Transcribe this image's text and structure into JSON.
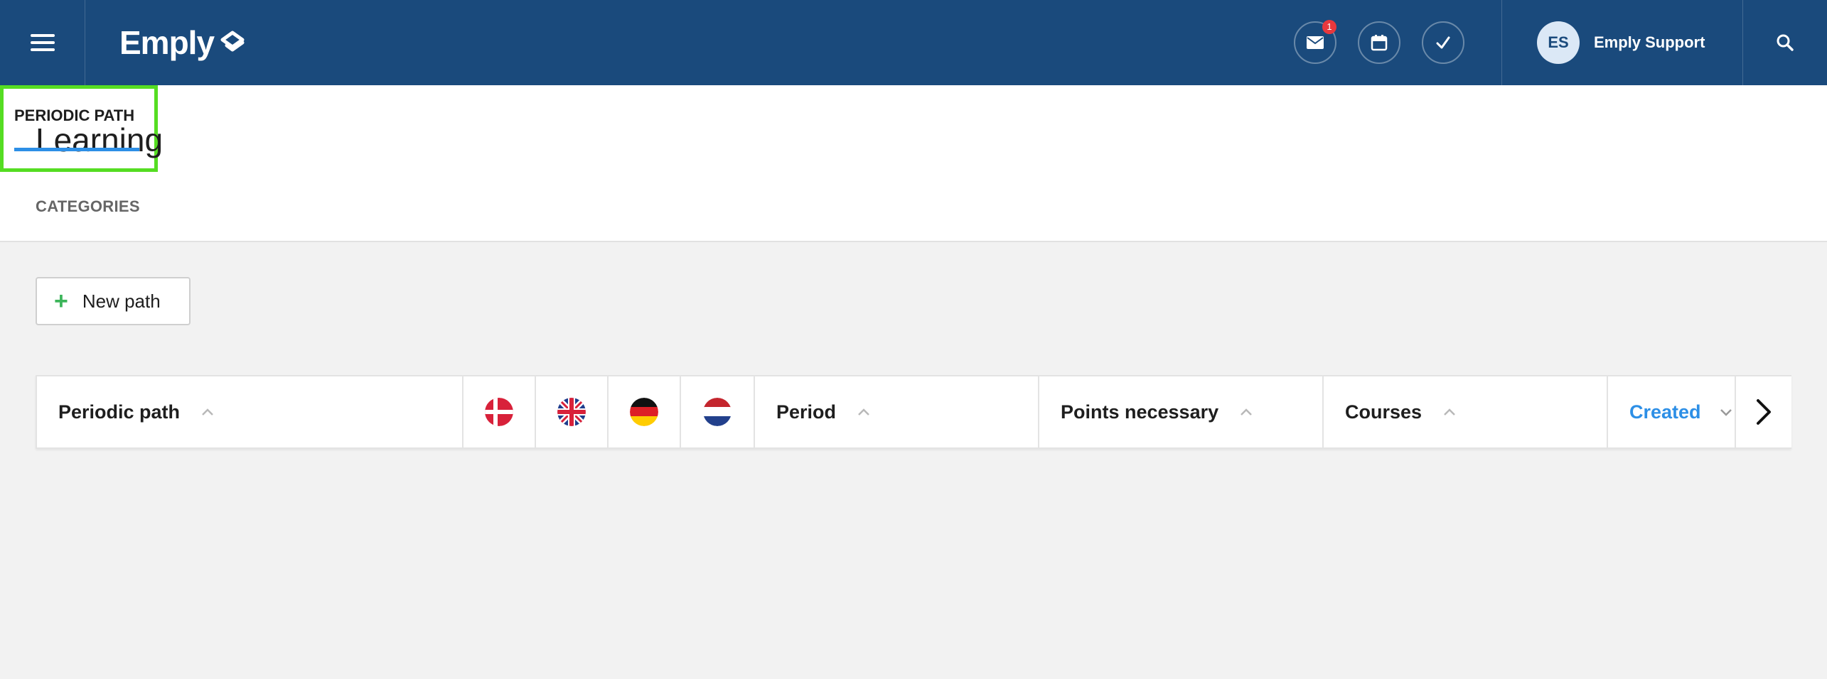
{
  "topbar": {
    "logo_text": "Emply",
    "menu_icon": "hamburger-menu-icon",
    "actions": [
      {
        "name": "messages",
        "icon": "envelope-icon",
        "badge": "1"
      },
      {
        "name": "calendar",
        "icon": "calendar-icon"
      },
      {
        "name": "tasks",
        "icon": "check-icon"
      }
    ],
    "user": {
      "initials": "ES",
      "name": "Emply Support"
    },
    "search_icon": "search-icon"
  },
  "page": {
    "title": "Learning",
    "tabs": [
      {
        "label": "CATEGORIES",
        "active": false
      },
      {
        "label": "PERIODIC PATH",
        "active": true
      }
    ]
  },
  "toolbar": {
    "new_path_label": "New path"
  },
  "table": {
    "columns": [
      {
        "label": "Periodic path",
        "sort": "asc"
      },
      {
        "flag": "Denmark"
      },
      {
        "flag": "United Kingdom"
      },
      {
        "flag": "Germany"
      },
      {
        "flag": "Netherlands"
      },
      {
        "label": "Period",
        "sort": "asc"
      },
      {
        "label": "Points necessary",
        "sort": "asc"
      },
      {
        "label": "Courses",
        "sort": "asc"
      },
      {
        "label": "Created",
        "sort": "desc",
        "active": true
      }
    ]
  },
  "colors": {
    "topbar": "#1a4a7c",
    "accent": "#2d8fe6",
    "highlight": "#55dd22",
    "plus": "#3cb55a",
    "badge": "#e8383d"
  }
}
